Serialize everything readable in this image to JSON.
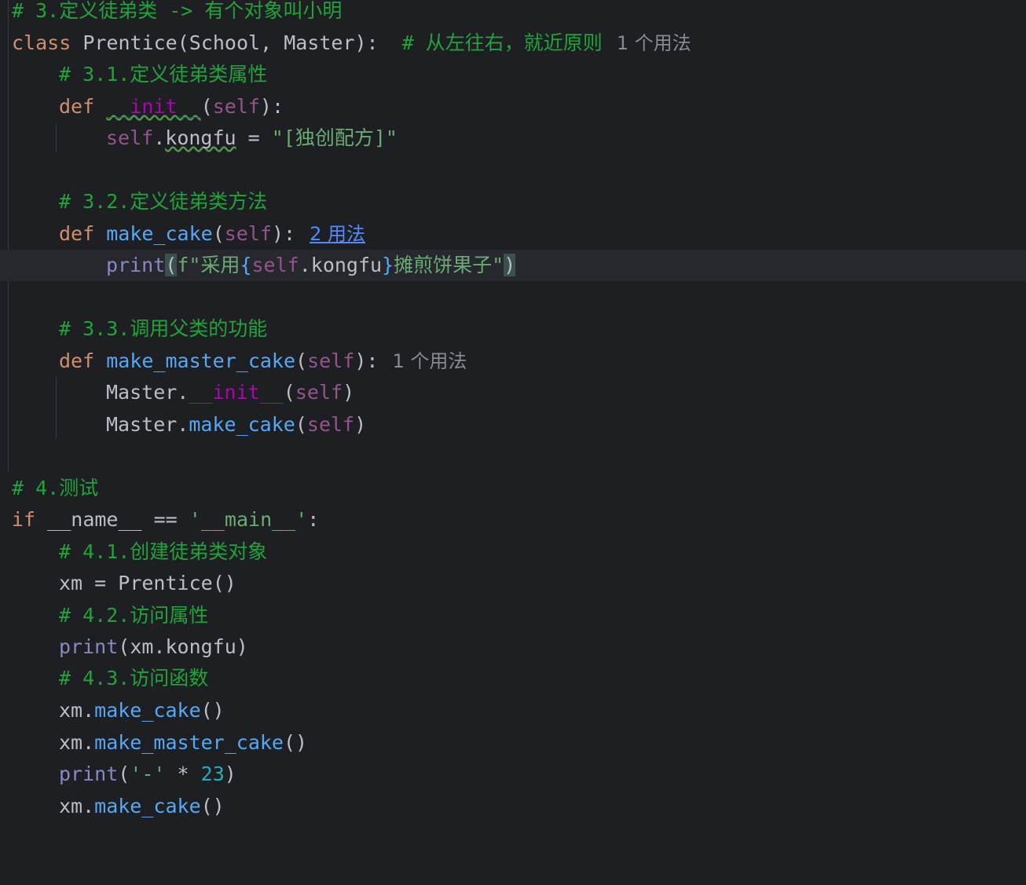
{
  "colors": {
    "background": "#1e1f22",
    "comment": "#22a33a",
    "keyword": "#cf8e6d",
    "self": "#94558d",
    "string": "#6aab73",
    "hint": "#868a91",
    "link_hint": "#548af7"
  },
  "lines": {
    "l0": "# 3.定义徒弟类 -> 有个对象叫小明",
    "l1a": "class",
    "l1b": " Prentice(School, Master):  ",
    "l1c": "# 从左往右，就近原则",
    "l1hint": "1 个用法",
    "l2": "# 3.1.定义徒弟类属性",
    "l3a": "def",
    "l3b": "__init__",
    "l3c": "(",
    "l3d": "self",
    "l3e": "):",
    "l4a": "self",
    "l4b": ".",
    "l4c": "kongfu",
    "l4d": " = ",
    "l4e": "\"[独创配方]\"",
    "l6": "# 3.2.定义徒弟类方法",
    "l7a": "def",
    "l7b": "make_cake",
    "l7c": "(",
    "l7d": "self",
    "l7e": "):",
    "l7hint": "2 用法",
    "l8a": "print",
    "l8b": "(",
    "l8c": "f\"采用",
    "l8d": "{",
    "l8e": "self",
    "l8f": ".kongfu",
    "l8g": "}",
    "l8h": "摊煎饼果子\"",
    "l8i": ")",
    "l10": "# 3.3.调用父类的功能",
    "l11a": "def",
    "l11b": "make_master_cake",
    "l11c": "(",
    "l11d": "self",
    "l11e": "):",
    "l11hint": "1 个用法",
    "l12a": "Master.",
    "l12b": "__init__",
    "l12c": "(",
    "l12d": "self",
    "l12e": ")",
    "l13a": "Master.",
    "l13b": "make_cake",
    "l13c": "(",
    "l13d": "self",
    "l13e": ")",
    "l15": "# 4.测试",
    "l16a": "if",
    "l16b": " __name__ == ",
    "l16c": "'__main__'",
    "l16d": ":",
    "l17": "# 4.1.创建徒弟类对象",
    "l18a": "xm = ",
    "l18b": "Prentice",
    "l18c": "()",
    "l19": "# 4.2.访问属性",
    "l20a": "print",
    "l20b": "(xm.kongfu)",
    "l21": "# 4.3.访问函数",
    "l22a": "xm.",
    "l22b": "make_cake",
    "l22c": "()",
    "l23a": "xm.",
    "l23b": "make_master_cake",
    "l23c": "()",
    "l24a": "print",
    "l24b": "(",
    "l24c": "'-'",
    "l24d": " * ",
    "l24e": "23",
    "l24f": ")",
    "l25a": "xm.",
    "l25b": "make_cake",
    "l25c": "()"
  }
}
